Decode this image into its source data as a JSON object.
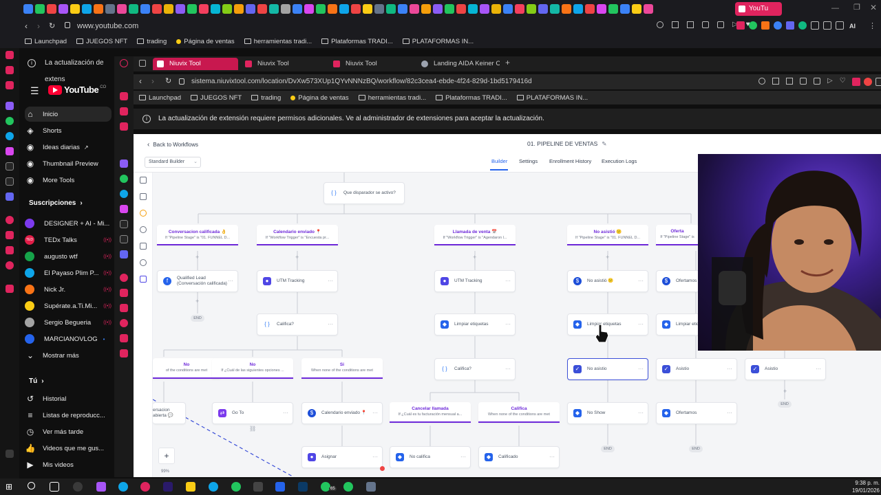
{
  "outer_browser": {
    "url": "www.youtube.com",
    "active_tab_label": "YouTu",
    "bookmarks": [
      "Launchpad",
      "JUEGOS NFT",
      "trading",
      "Página de ventas",
      "herramientas tradi...",
      "Plataformas TRADI...",
      "PLATAFORMAS IN..."
    ],
    "update_notice": "La actualización de extens"
  },
  "youtube": {
    "logo": "YouTube",
    "country": "CO",
    "nav": [
      {
        "label": "Inicio",
        "icon": "home-icon"
      },
      {
        "label": "Shorts",
        "icon": "shorts-icon"
      },
      {
        "label": "Ideas diarias",
        "icon": "lightbulb-icon"
      },
      {
        "label": "Thumbnail Preview",
        "icon": "image-icon"
      },
      {
        "label": "More Tools",
        "icon": "tools-icon"
      }
    ],
    "subscriptions_title": "Suscripciones",
    "subscriptions": [
      "DESIGNER + AI - Mi...",
      "TEDx Talks",
      "augusto wtf",
      "El Payaso Plim P...",
      "Nick Jr.",
      "Supérate.a.Ti.Mi...",
      "Sergio Begueria",
      "MARCIANOVLOG"
    ],
    "show_more": "Mostrar más",
    "you_title": "Tú",
    "you_items": [
      "Historial",
      "Listas de reproducc...",
      "Ver más tarde",
      "Videos que me gus...",
      "Mis videos"
    ]
  },
  "inner_browser": {
    "tabs": [
      "Niuvix Tool",
      "Niuvix Tool",
      "Niuvix Tool",
      "Landing AIDA Keiner Char"
    ],
    "url": "sistema.niuvixtool.com/location/DvXw573XUp1QYvNNNzBQ/workflow/82c3cea4-ebde-4f24-829d-1bd5179416d",
    "bookmarks": [
      "Launchpad",
      "JUEGOS NFT",
      "trading",
      "Página de ventas",
      "herramientas tradi...",
      "Plataformas TRADI...",
      "PLATAFORMAS IN..."
    ],
    "notice": "La actualización de extensión requiere permisos adicionales. Ve al administrador de extensiones para aceptar la actualización."
  },
  "workflow": {
    "back_label": "Back to Workflows",
    "title": "01. PIPELINE DE VENTAS",
    "builder_select": "Standard Builder",
    "tabs": [
      "Builder",
      "Settings",
      "Enrollment History",
      "Execution Logs"
    ],
    "top_node": "Que disparador se activo?",
    "triggers": [
      {
        "title": "Conversacion calificada 👌",
        "sub": "If \"Pipeline Stage\" is \"01. FUNNEL D..."
      },
      {
        "title": "Calendario enviado 📍",
        "sub": "If \"Workflow Trigger\" is \"Encuesta pr..."
      },
      {
        "title": "Llamada de venta 📅",
        "sub": "If \"Workflow Trigger\" is \"Agendaron l..."
      },
      {
        "title": "No asistió 😕",
        "sub": "If \"Pipeline Stage\" is \"01. FUNNEL D..."
      },
      {
        "title": "Oferta",
        "sub": "If \"Pipeline Stage\" is"
      }
    ],
    "nodes": {
      "qualified_lead": "Qualified Lead (Conversación calificada)",
      "utm1": "UTM Tracking",
      "utm2": "UTM Tracking",
      "no_asistio": "No asistió 😕",
      "ofertamos1": "Ofertamos",
      "califica1": "Califica?",
      "limpiar1": "Limpiar etiquetas",
      "limpiar2": "Limpiar etiquetas",
      "limpiar3": "Limpiar etiq",
      "califica2": "Califica?",
      "no_asistio2": "No asistio",
      "asistio1": "Asistio",
      "asistio2": "Asistio",
      "go_to": "Go To",
      "calendario": "Calendario enviado 📍",
      "no_show": "No Show",
      "ofertamos2": "Ofertamos",
      "asignar": "Asignar",
      "no_califica": "No califica",
      "calificado": "Calificado",
      "conv_abierta": "ersacion abierta 💬"
    },
    "branches": [
      {
        "title": "No",
        "sub": "of the conditions are met"
      },
      {
        "title": "No",
        "sub": "If ¿Cuál de las siguientes opciones ..."
      },
      {
        "title": "Si",
        "sub": "When none of the conditions are met"
      },
      {
        "title": "Cancelar llamada",
        "sub": "If ¿Cuál es tu facturación mensual a..."
      },
      {
        "title": "Califica",
        "sub": "When none of the conditions are met"
      }
    ],
    "end_label": "END",
    "zoom": "99%"
  },
  "taskbar": {
    "time": "9:38 p. m.",
    "date": "19/01/2026",
    "badge": "65"
  },
  "colors": {
    "accent_blue": "#2563eb",
    "trigger_purple": "#6d28d9",
    "yt_red": "#ff0033",
    "opera_red": "#e0245e"
  }
}
